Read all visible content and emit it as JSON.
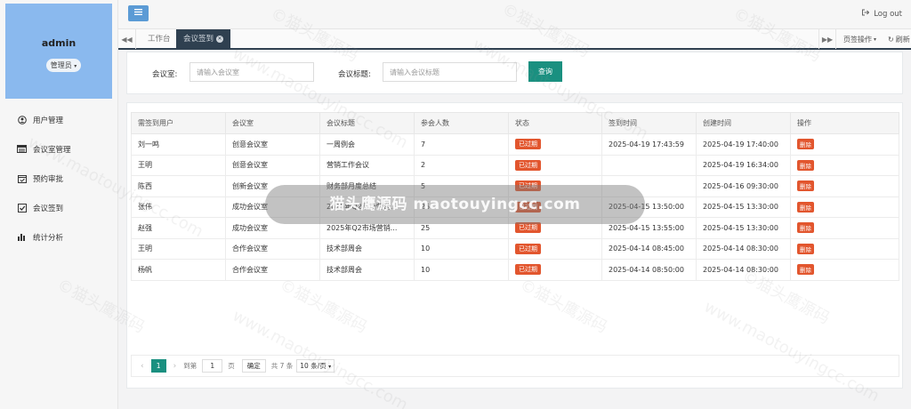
{
  "user": {
    "name": "admin",
    "role": "管理员"
  },
  "sidebar": {
    "items": [
      {
        "label": "用户管理",
        "icon": "user-icon"
      },
      {
        "label": "会议室管理",
        "icon": "room-icon"
      },
      {
        "label": "预约审批",
        "icon": "approval-icon"
      },
      {
        "label": "会议签到",
        "icon": "checkin-icon"
      },
      {
        "label": "统计分析",
        "icon": "chart-icon"
      }
    ]
  },
  "header": {
    "logout_label": "Log out"
  },
  "tabs": {
    "items": [
      {
        "label": "工作台",
        "active": false
      },
      {
        "label": "会议签到",
        "active": true
      }
    ],
    "page_ops_label": "页签操作",
    "refresh_label": "刷新"
  },
  "search": {
    "room_label": "会议室:",
    "room_placeholder": "请输入会议室",
    "title_label": "会议标题:",
    "title_placeholder": "请输入会议标题",
    "query_label": "查询"
  },
  "table": {
    "columns": [
      "需签到用户",
      "会议室",
      "会议标题",
      "参会人数",
      "状态",
      "签到时间",
      "创建时间",
      "操作"
    ],
    "rows": [
      {
        "user": "刘一鸣",
        "room": "创意会议室",
        "title": "一周例会",
        "count": "7",
        "status": "已过期",
        "checkin": "2025-04-19 17:43:59",
        "created": "2025-04-19 17:40:00",
        "action": "删除"
      },
      {
        "user": "王明",
        "room": "创意会议室",
        "title": "营销工作会议",
        "count": "2",
        "status": "已过期",
        "checkin": "",
        "created": "2025-04-19 16:34:00",
        "action": "删除"
      },
      {
        "user": "陈西",
        "room": "创新会议室",
        "title": "财务部月度总结",
        "count": "5",
        "status": "已过期",
        "checkin": "",
        "created": "2025-04-16 09:30:00",
        "action": "删除"
      },
      {
        "user": "张伟",
        "room": "成功会议室",
        "title": "2025年Q2市场营销...",
        "count": "25",
        "status": "已过期",
        "checkin": "2025-04-15 13:50:00",
        "created": "2025-04-15 13:30:00",
        "action": "删除"
      },
      {
        "user": "赵强",
        "room": "成功会议室",
        "title": "2025年Q2市场营销...",
        "count": "25",
        "status": "已过期",
        "checkin": "2025-04-15 13:55:00",
        "created": "2025-04-15 13:30:00",
        "action": "删除"
      },
      {
        "user": "王明",
        "room": "合作会议室",
        "title": "技术部周会",
        "count": "10",
        "status": "已过期",
        "checkin": "2025-04-14 08:45:00",
        "created": "2025-04-14 08:30:00",
        "action": "删除"
      },
      {
        "user": "杨帆",
        "room": "合作会议室",
        "title": "技术部周会",
        "count": "10",
        "status": "已过期",
        "checkin": "2025-04-14 08:50:00",
        "created": "2025-04-14 08:30:00",
        "action": "删除"
      }
    ]
  },
  "pager": {
    "current_page": "1",
    "goto_label": "到第",
    "page_input": "1",
    "page_unit": "页",
    "confirm_label": "确定",
    "total_label": "共 7 条",
    "page_size_label": "10 条/页"
  },
  "watermark": {
    "banner_text": "猫头鹰源码 maotouyingcc.com",
    "text_cn": "©猫头鹰源码",
    "text_url": "www.maotouyingcc.com"
  },
  "colors": {
    "primary": "#1a9080",
    "danger": "#e2562e",
    "profile_bg": "#8ab9ee",
    "tab_active": "#2f4050"
  }
}
